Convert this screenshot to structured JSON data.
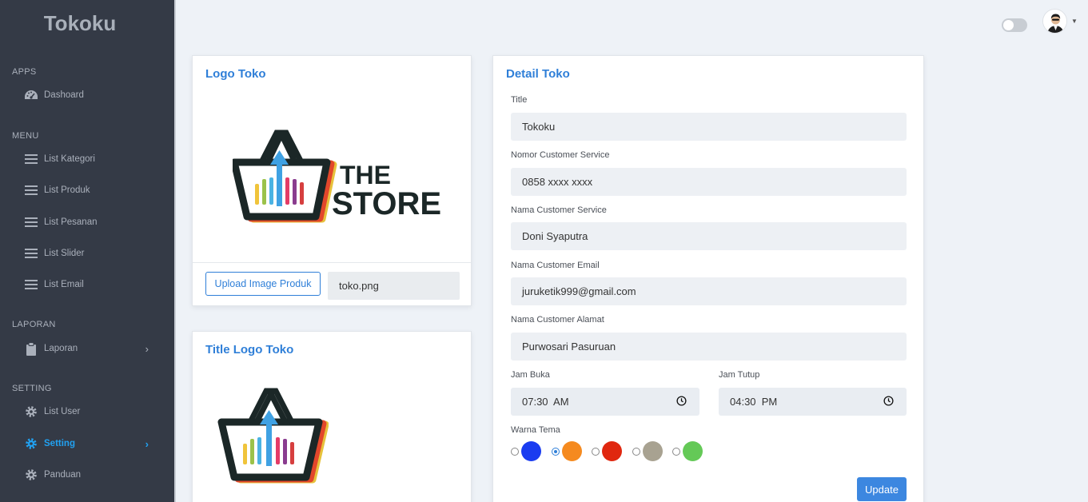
{
  "sidebar": {
    "brand": "Tokoku",
    "sections": {
      "apps": "APPS",
      "menu": "MENU",
      "laporan": "LAPORAN",
      "setting": "SETTING"
    },
    "items": {
      "dashboard": "Dashoard",
      "list_kategori": "List Kategori",
      "list_produk": "List Produk",
      "list_pesanan": "List Pesanan",
      "list_slider": "List Slider",
      "list_email": "List Email",
      "laporan": "Laporan",
      "list_user": "List User",
      "setting": "Setting",
      "panduan": "Panduan"
    },
    "active_color": "#21a1f1"
  },
  "logo_card": {
    "title": "Logo Toko",
    "upload_label": "Upload Image Produk",
    "file_name": "toko.png",
    "logo_text_1": "THE",
    "logo_text_2": "STORE"
  },
  "title_logo_card": {
    "title": "Title Logo Toko"
  },
  "detail_card": {
    "title": "Detail Toko",
    "fields": {
      "title_label": "Title",
      "title_value": "Tokoku",
      "cs_number_label": "Nomor Customer Service",
      "cs_number_value": "0858 xxxx xxxx",
      "cs_name_label": "Nama Customer Service",
      "cs_name_value": "Doni Syaputra",
      "cs_email_label": "Nama Customer Email",
      "cs_email_value": "juruketik999@gmail.com",
      "cs_address_label": "Nama Customer Alamat",
      "cs_address_value": "Purwosari Pasuruan",
      "open_label": "Jam Buka",
      "open_value": "07:30  AM",
      "close_label": "Jam Tutup",
      "close_value": "04:30  PM",
      "theme_label": "Warna Tema"
    },
    "theme_colors": [
      "#1a3cf0",
      "#f58a1f",
      "#e0270f",
      "#a8a291",
      "#64c957"
    ],
    "selected_theme_index": 1,
    "update_label": "Update"
  }
}
